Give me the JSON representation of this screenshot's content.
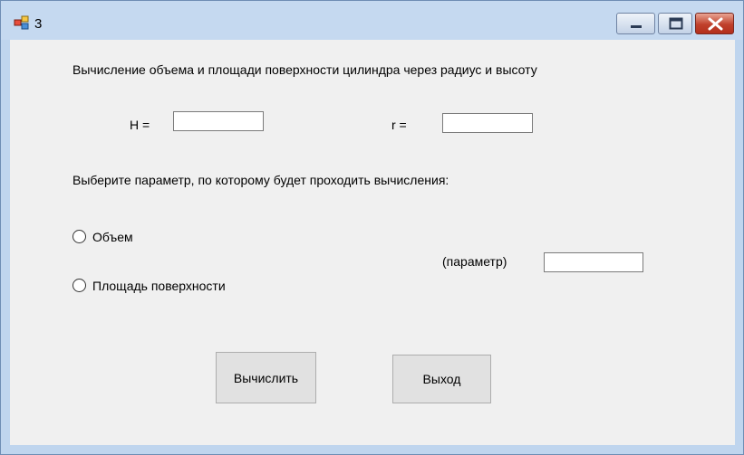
{
  "window": {
    "title": "3",
    "icon": "app-icon",
    "controls": {
      "minimize": "minimize-icon",
      "maximize": "maximize-icon",
      "close": "close-icon"
    }
  },
  "form": {
    "heading": "Вычисление объема и площади поверхности цилиндра через радиус и высоту",
    "height_label": "H =",
    "height_value": "",
    "radius_label": "r =",
    "radius_value": "",
    "choose_label": "Выберите параметр, по которому будет проходить вычисления:",
    "options": [
      {
        "label": "Объем",
        "checked": false
      },
      {
        "label": "Площадь поверхности",
        "checked": false
      }
    ],
    "param_label": "(параметр)",
    "param_value": "",
    "calc_button": "Вычислить",
    "exit_button": "Выход"
  },
  "colors": {
    "window_frame": "#bfd5ee",
    "client_background": "#f0f0f0",
    "button_face": "#e1e1e1",
    "close_button": "#c0412c"
  }
}
